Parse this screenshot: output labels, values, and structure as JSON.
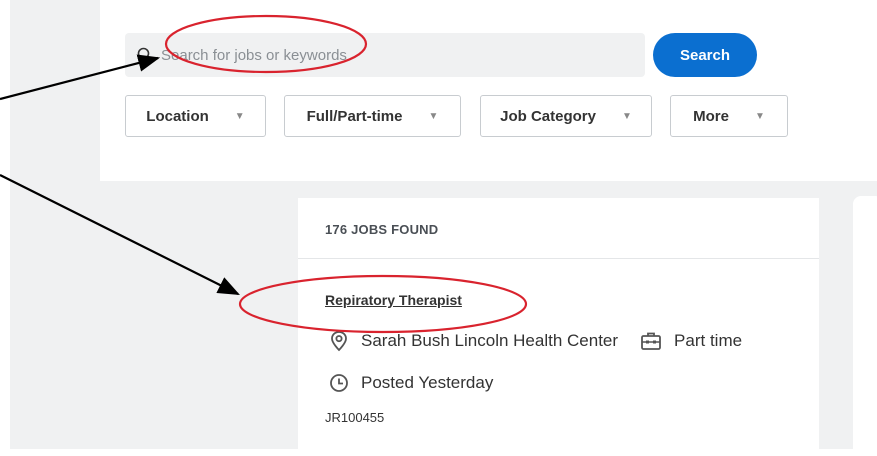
{
  "search": {
    "placeholder": "Search for jobs or keywords",
    "button_label": "Search"
  },
  "filters": [
    {
      "label": "Location"
    },
    {
      "label": "Full/Part-time"
    },
    {
      "label": "Job Category"
    },
    {
      "label": "More"
    }
  ],
  "results": {
    "count_label": "176 JOBS FOUND",
    "jobs": [
      {
        "title": "Repiratory Therapist",
        "location": "Sarah Bush Lincoln Health Center",
        "time_type": "Part time",
        "posted": "Posted Yesterday",
        "req_id": "JR100455"
      }
    ]
  },
  "colors": {
    "primary": "#0b6fd0",
    "annotation": "#d9232e",
    "page_bg": "#f0f1f2"
  }
}
